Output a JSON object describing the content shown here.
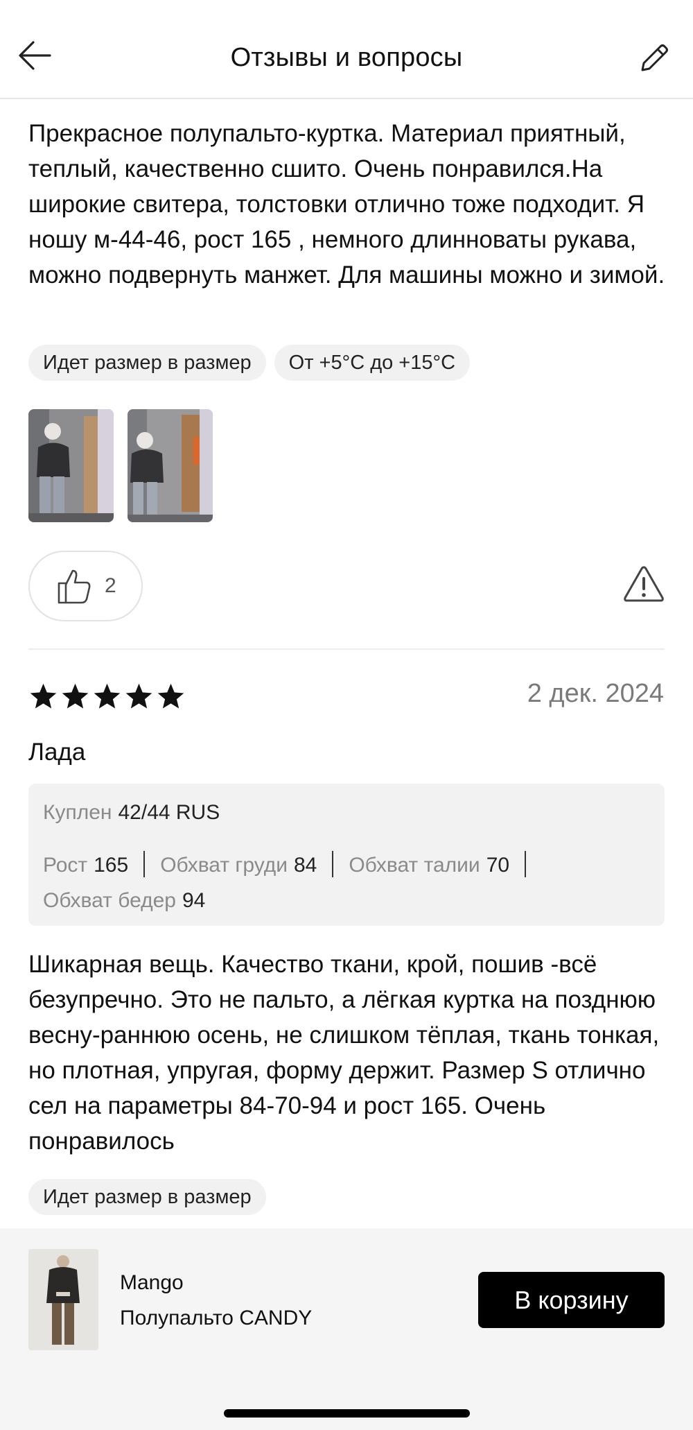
{
  "header": {
    "title": "Отзывы и вопросы",
    "back_icon": "arrow-left-icon",
    "edit_icon": "pencil-icon"
  },
  "review1": {
    "text": "Прекрасное полупальто-куртка. Материал приятный, теплый, качественно сшито. Очень понравился.На широкие свитера, толстовки отлично тоже подходит. Я ношу м-44-46, рост 165 , немного длинноваты рукава, можно подвернуть манжет. Для машины можно и зимой.",
    "tags": [
      "Идет размер в размер",
      "От +5°C до +15°C"
    ],
    "photo_count": 2,
    "likes": "2"
  },
  "review2": {
    "rating": 5,
    "date": "2 дек. 2024",
    "author": "Лада",
    "purchased_label": "Куплен",
    "purchased_value": "42/44 RUS",
    "params": [
      {
        "label": "Рост",
        "value": "165"
      },
      {
        "label": "Обхват груди",
        "value": "84"
      },
      {
        "label": "Обхват талии",
        "value": "70"
      },
      {
        "label": "Обхват бедер",
        "value": "94"
      }
    ],
    "text": "Шикарная вещь. Качество ткани, крой, пошив -всё безупречно. Это не пальто, а лёгкая куртка на позднюю весну-раннюю осень, не слишком тёплая, ткань тонкая, но плотная, упругая, форму держит. Размер S отлично сел на параметры 84-70-94 и рост 165. Очень понравилось",
    "tags": [
      "Идет размер в размер"
    ]
  },
  "product": {
    "brand": "Mango",
    "name": "Полупальто CANDY",
    "cart_label": "В корзину"
  },
  "colors": {
    "text": "#111111",
    "muted": "#7a7a7a",
    "tag_bg": "#f1f1f1",
    "panel_bg": "#f2f2f2",
    "button_bg": "#000000"
  }
}
